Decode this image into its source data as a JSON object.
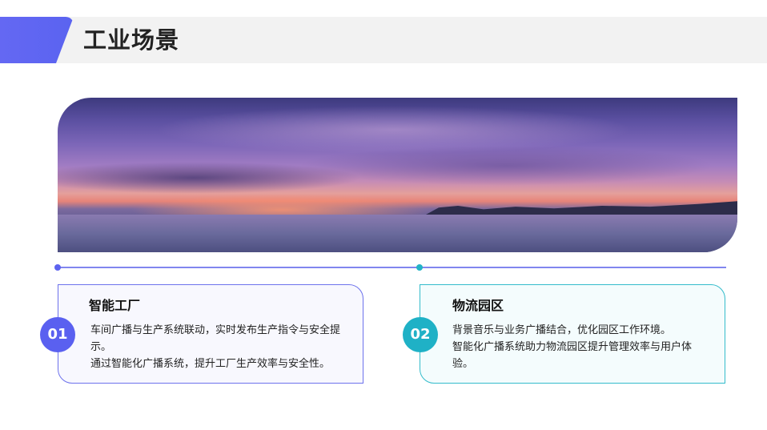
{
  "header": {
    "title": "工业场景"
  },
  "colors": {
    "accent_blue": "#5a60f0",
    "accent_teal": "#1fb1c6",
    "band": "#f2f2f2"
  },
  "cards": [
    {
      "number": "01",
      "title": "智能工厂",
      "lines": [
        "车间广播与生产系统联动，实时发布生产指令与安全提示。",
        "通过智能化广播系统，提升工厂生产效率与安全性。"
      ]
    },
    {
      "number": "02",
      "title": "物流园区",
      "lines": [
        "背景音乐与业务广播结合，优化园区工作环境。",
        "智能化广播系统助力物流园区提升管理效率与用户体验。"
      ]
    }
  ]
}
